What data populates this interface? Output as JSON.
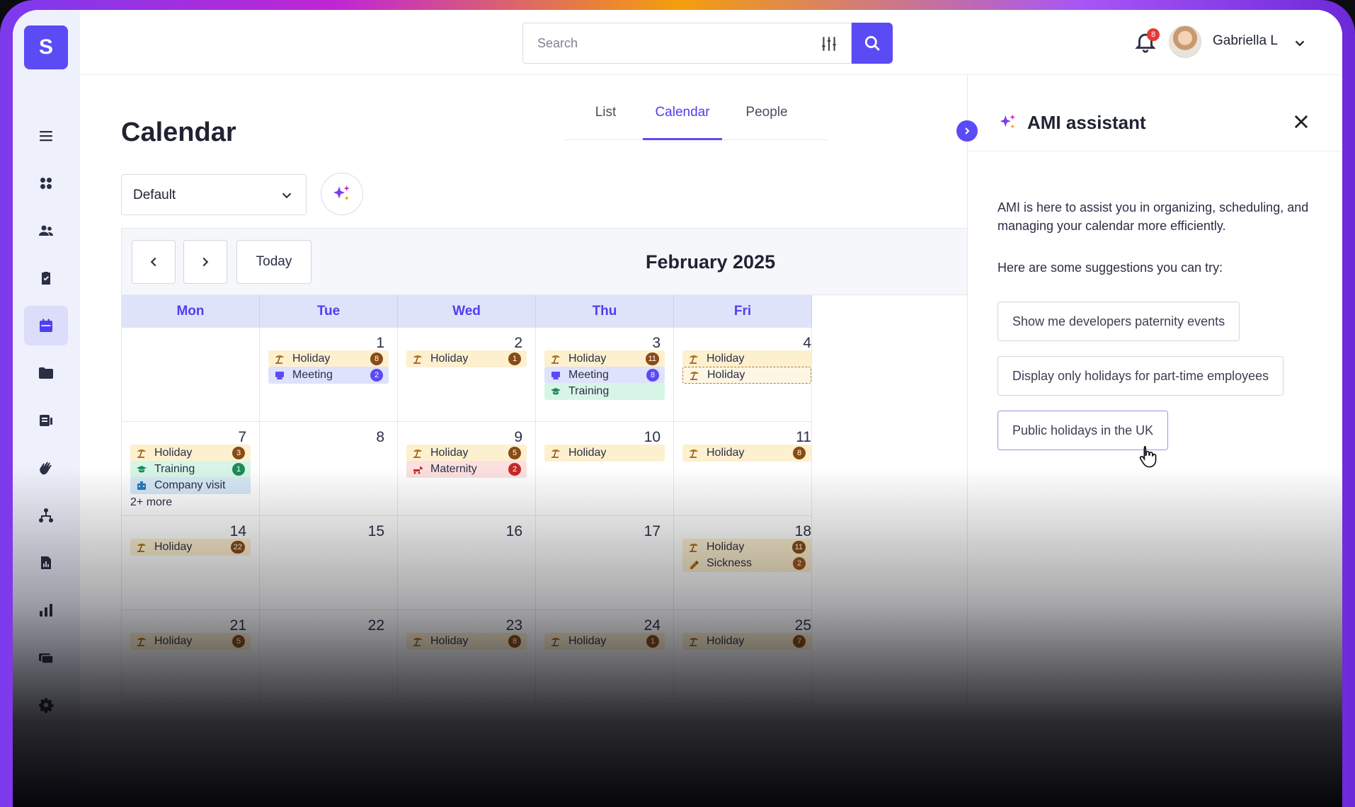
{
  "header": {
    "search_placeholder": "Search",
    "notification_count": "8",
    "user_name": "Gabriella L"
  },
  "sidebar": {
    "logo_letter": "S",
    "items": [
      "menu",
      "dashboard",
      "people",
      "tasks",
      "calendar",
      "files",
      "documents",
      "hand",
      "org-chart",
      "reports",
      "analytics",
      "assets",
      "settings"
    ],
    "active": "calendar"
  },
  "page": {
    "title": "Calendar",
    "tabs": [
      {
        "label": "List"
      },
      {
        "label": "Calendar",
        "active": true
      },
      {
        "label": "People"
      }
    ],
    "view_select": "Default"
  },
  "calendar": {
    "today_label": "Today",
    "month_label": "February 2025",
    "weekdays": [
      "Mon",
      "Tue",
      "Wed",
      "Thu",
      "Fri"
    ],
    "weeks": [
      [
        {
          "day": "",
          "events": []
        },
        {
          "day": "1",
          "events": [
            {
              "type": "holiday",
              "label": "Holiday",
              "count": "8"
            },
            {
              "type": "meeting",
              "label": "Meeting",
              "count": "2"
            }
          ]
        },
        {
          "day": "2",
          "events": [
            {
              "type": "holiday",
              "label": "Holiday",
              "count": "1"
            }
          ]
        },
        {
          "day": "3",
          "events": [
            {
              "type": "holiday",
              "label": "Holiday",
              "count": "11"
            },
            {
              "type": "meeting",
              "label": "Meeting",
              "count": "8"
            },
            {
              "type": "training",
              "label": "Training",
              "count": ""
            }
          ]
        },
        {
          "day": "4",
          "events": [
            {
              "type": "holiday",
              "label": "Holiday",
              "count": ""
            },
            {
              "type": "dashed",
              "label": "Holiday",
              "count": ""
            }
          ]
        }
      ],
      [
        {
          "day": "7",
          "events": [
            {
              "type": "holiday",
              "label": "Holiday",
              "count": "3"
            },
            {
              "type": "training",
              "label": "Training",
              "count": "1"
            },
            {
              "type": "company",
              "label": "Company visit",
              "count": ""
            }
          ],
          "more": "2+ more"
        },
        {
          "day": "8",
          "events": []
        },
        {
          "day": "9",
          "events": [
            {
              "type": "holiday",
              "label": "Holiday",
              "count": "5"
            },
            {
              "type": "maternity",
              "label": "Maternity",
              "count": "2"
            }
          ]
        },
        {
          "day": "10",
          "events": [
            {
              "type": "holiday",
              "label": "Holiday",
              "count": ""
            }
          ]
        },
        {
          "day": "11",
          "events": [
            {
              "type": "holiday",
              "label": "Holiday",
              "count": "8"
            }
          ]
        }
      ],
      [
        {
          "day": "14",
          "events": [
            {
              "type": "holiday",
              "label": "Holiday",
              "count": "22"
            }
          ]
        },
        {
          "day": "15",
          "events": []
        },
        {
          "day": "16",
          "events": []
        },
        {
          "day": "17",
          "events": []
        },
        {
          "day": "18",
          "events": [
            {
              "type": "holiday",
              "label": "Holiday",
              "count": "11"
            },
            {
              "type": "sickness",
              "label": "Sickness",
              "count": "2"
            }
          ]
        }
      ],
      [
        {
          "day": "21",
          "events": [
            {
              "type": "holiday",
              "label": "Holiday",
              "count": "5"
            }
          ]
        },
        {
          "day": "22",
          "events": []
        },
        {
          "day": "23",
          "events": [
            {
              "type": "holiday",
              "label": "Holiday",
              "count": "8"
            }
          ]
        },
        {
          "day": "24",
          "events": [
            {
              "type": "holiday",
              "label": "Holiday",
              "count": "1"
            }
          ]
        },
        {
          "day": "25",
          "events": [
            {
              "type": "holiday",
              "label": "Holiday",
              "count": "7"
            }
          ]
        }
      ]
    ]
  },
  "assistant": {
    "title": "AMI assistant",
    "intro": "AMI is here to assist you in organizing, scheduling, and managing your calendar more efficiently.",
    "hint": "Here are some suggestions you can try:",
    "suggestions": [
      "Show me developers paternity events",
      "Display only holidays for part-time employees",
      "Public holidays in the UK"
    ]
  },
  "colors": {
    "accent": "#5b4bf5",
    "holiday": "#fdf0cf",
    "meeting": "#dfe2fb",
    "training": "#d7f5e6",
    "maternity": "#fbe0e0"
  }
}
